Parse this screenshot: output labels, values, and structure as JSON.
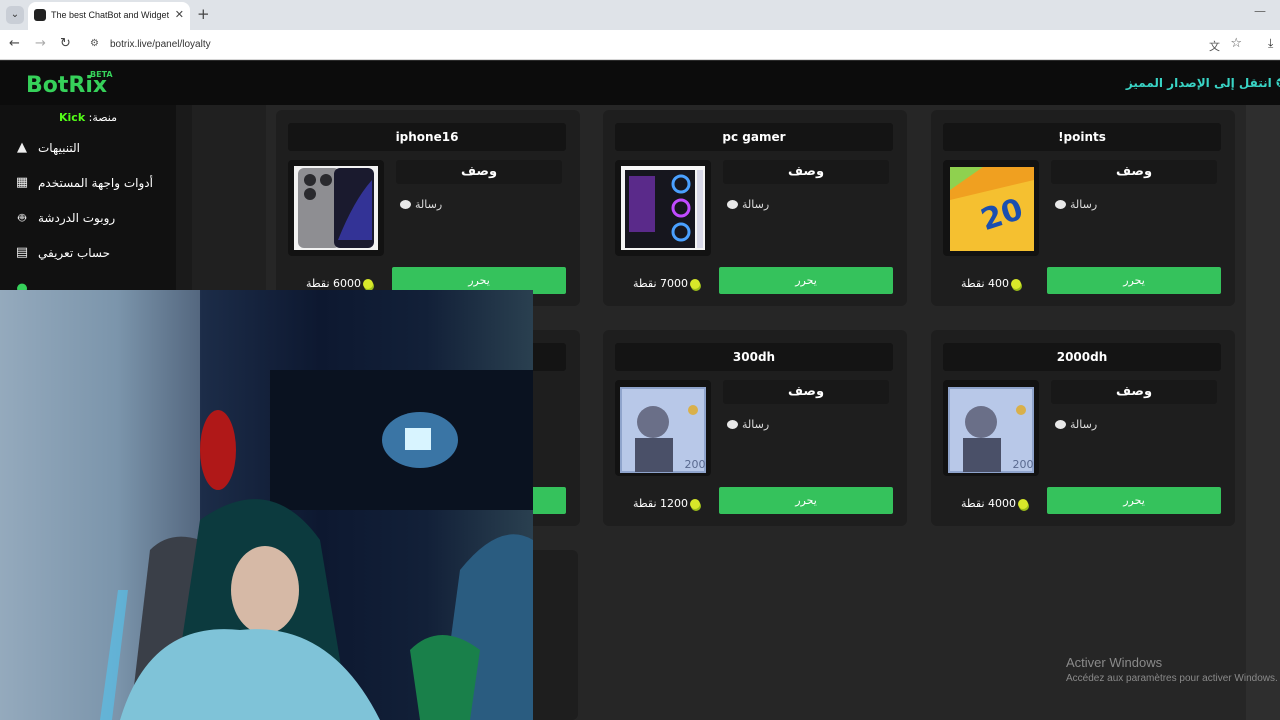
{
  "browser": {
    "tab_title": "The best ChatBot and Widgets",
    "url": "botrix.live/panel/loyalty"
  },
  "header": {
    "logo": "BotRix",
    "beta": "BETA",
    "premium_link": "انتقل إلى الإصدار المميز"
  },
  "sidebar": {
    "platform_label": "منصة:",
    "platform_name": "Kick",
    "items": [
      {
        "label": "التنبيهات",
        "icon": "warning-icon"
      },
      {
        "label": "أدوات واجهة المستخدم",
        "icon": "widgets-icon"
      },
      {
        "label": "روبوت الدردشة",
        "icon": "robot-icon"
      },
      {
        "label": "حساب تعريفي",
        "icon": "id-card-icon"
      }
    ]
  },
  "rewards": [
    {
      "title": "!points",
      "description": "وصف",
      "message": "رسالة",
      "cost": "400 نقطة",
      "redeem_label": "يحرر"
    },
    {
      "title": "pc gamer",
      "description": "وصف",
      "message": "رسالة",
      "cost": "7000 نقطة",
      "redeem_label": "يحرر"
    },
    {
      "title": "iphone16",
      "description": "وصف",
      "message": "رسالة",
      "cost": "6000 نقطة",
      "redeem_label": "يحرر"
    },
    {
      "title": "2000dh",
      "description": "وصف",
      "message": "رسالة",
      "cost": "4000 نقطة",
      "redeem_label": "يحرر"
    },
    {
      "title": "300dh",
      "description": "وصف",
      "message": "رسالة",
      "cost": "1200 نقطة",
      "redeem_label": "يحرر"
    }
  ],
  "colors": {
    "accent_green": "#35c25c",
    "logo_green": "#36d15a",
    "premium_cyan": "#39d4c5",
    "kick_green": "#53fc18"
  },
  "windows_watermark": {
    "line1": "Activer Windows",
    "line2": "Accédez aux paramètres pour activer Windows."
  }
}
